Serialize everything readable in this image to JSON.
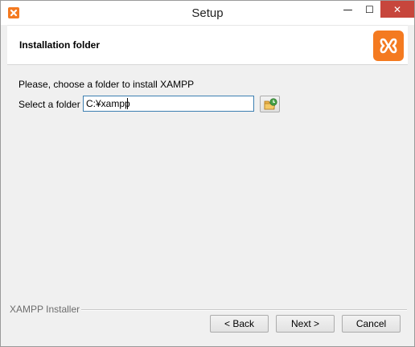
{
  "window": {
    "title": "Setup",
    "controls": {
      "minimize": "—",
      "maximize": "☐",
      "close": "✕"
    }
  },
  "header": {
    "title": "Installation folder",
    "logo_icon": "xampp-logo-icon",
    "brand_color": "#f47a20"
  },
  "main": {
    "prompt": "Please, choose a folder to install XAMPP",
    "folder_label": "Select a folder",
    "folder_value": "C:¥xampp",
    "browse_icon": "folder-browse-icon"
  },
  "footer": {
    "group_label": "XAMPP Installer",
    "back_label": "< Back",
    "next_label": "Next >",
    "cancel_label": "Cancel"
  }
}
